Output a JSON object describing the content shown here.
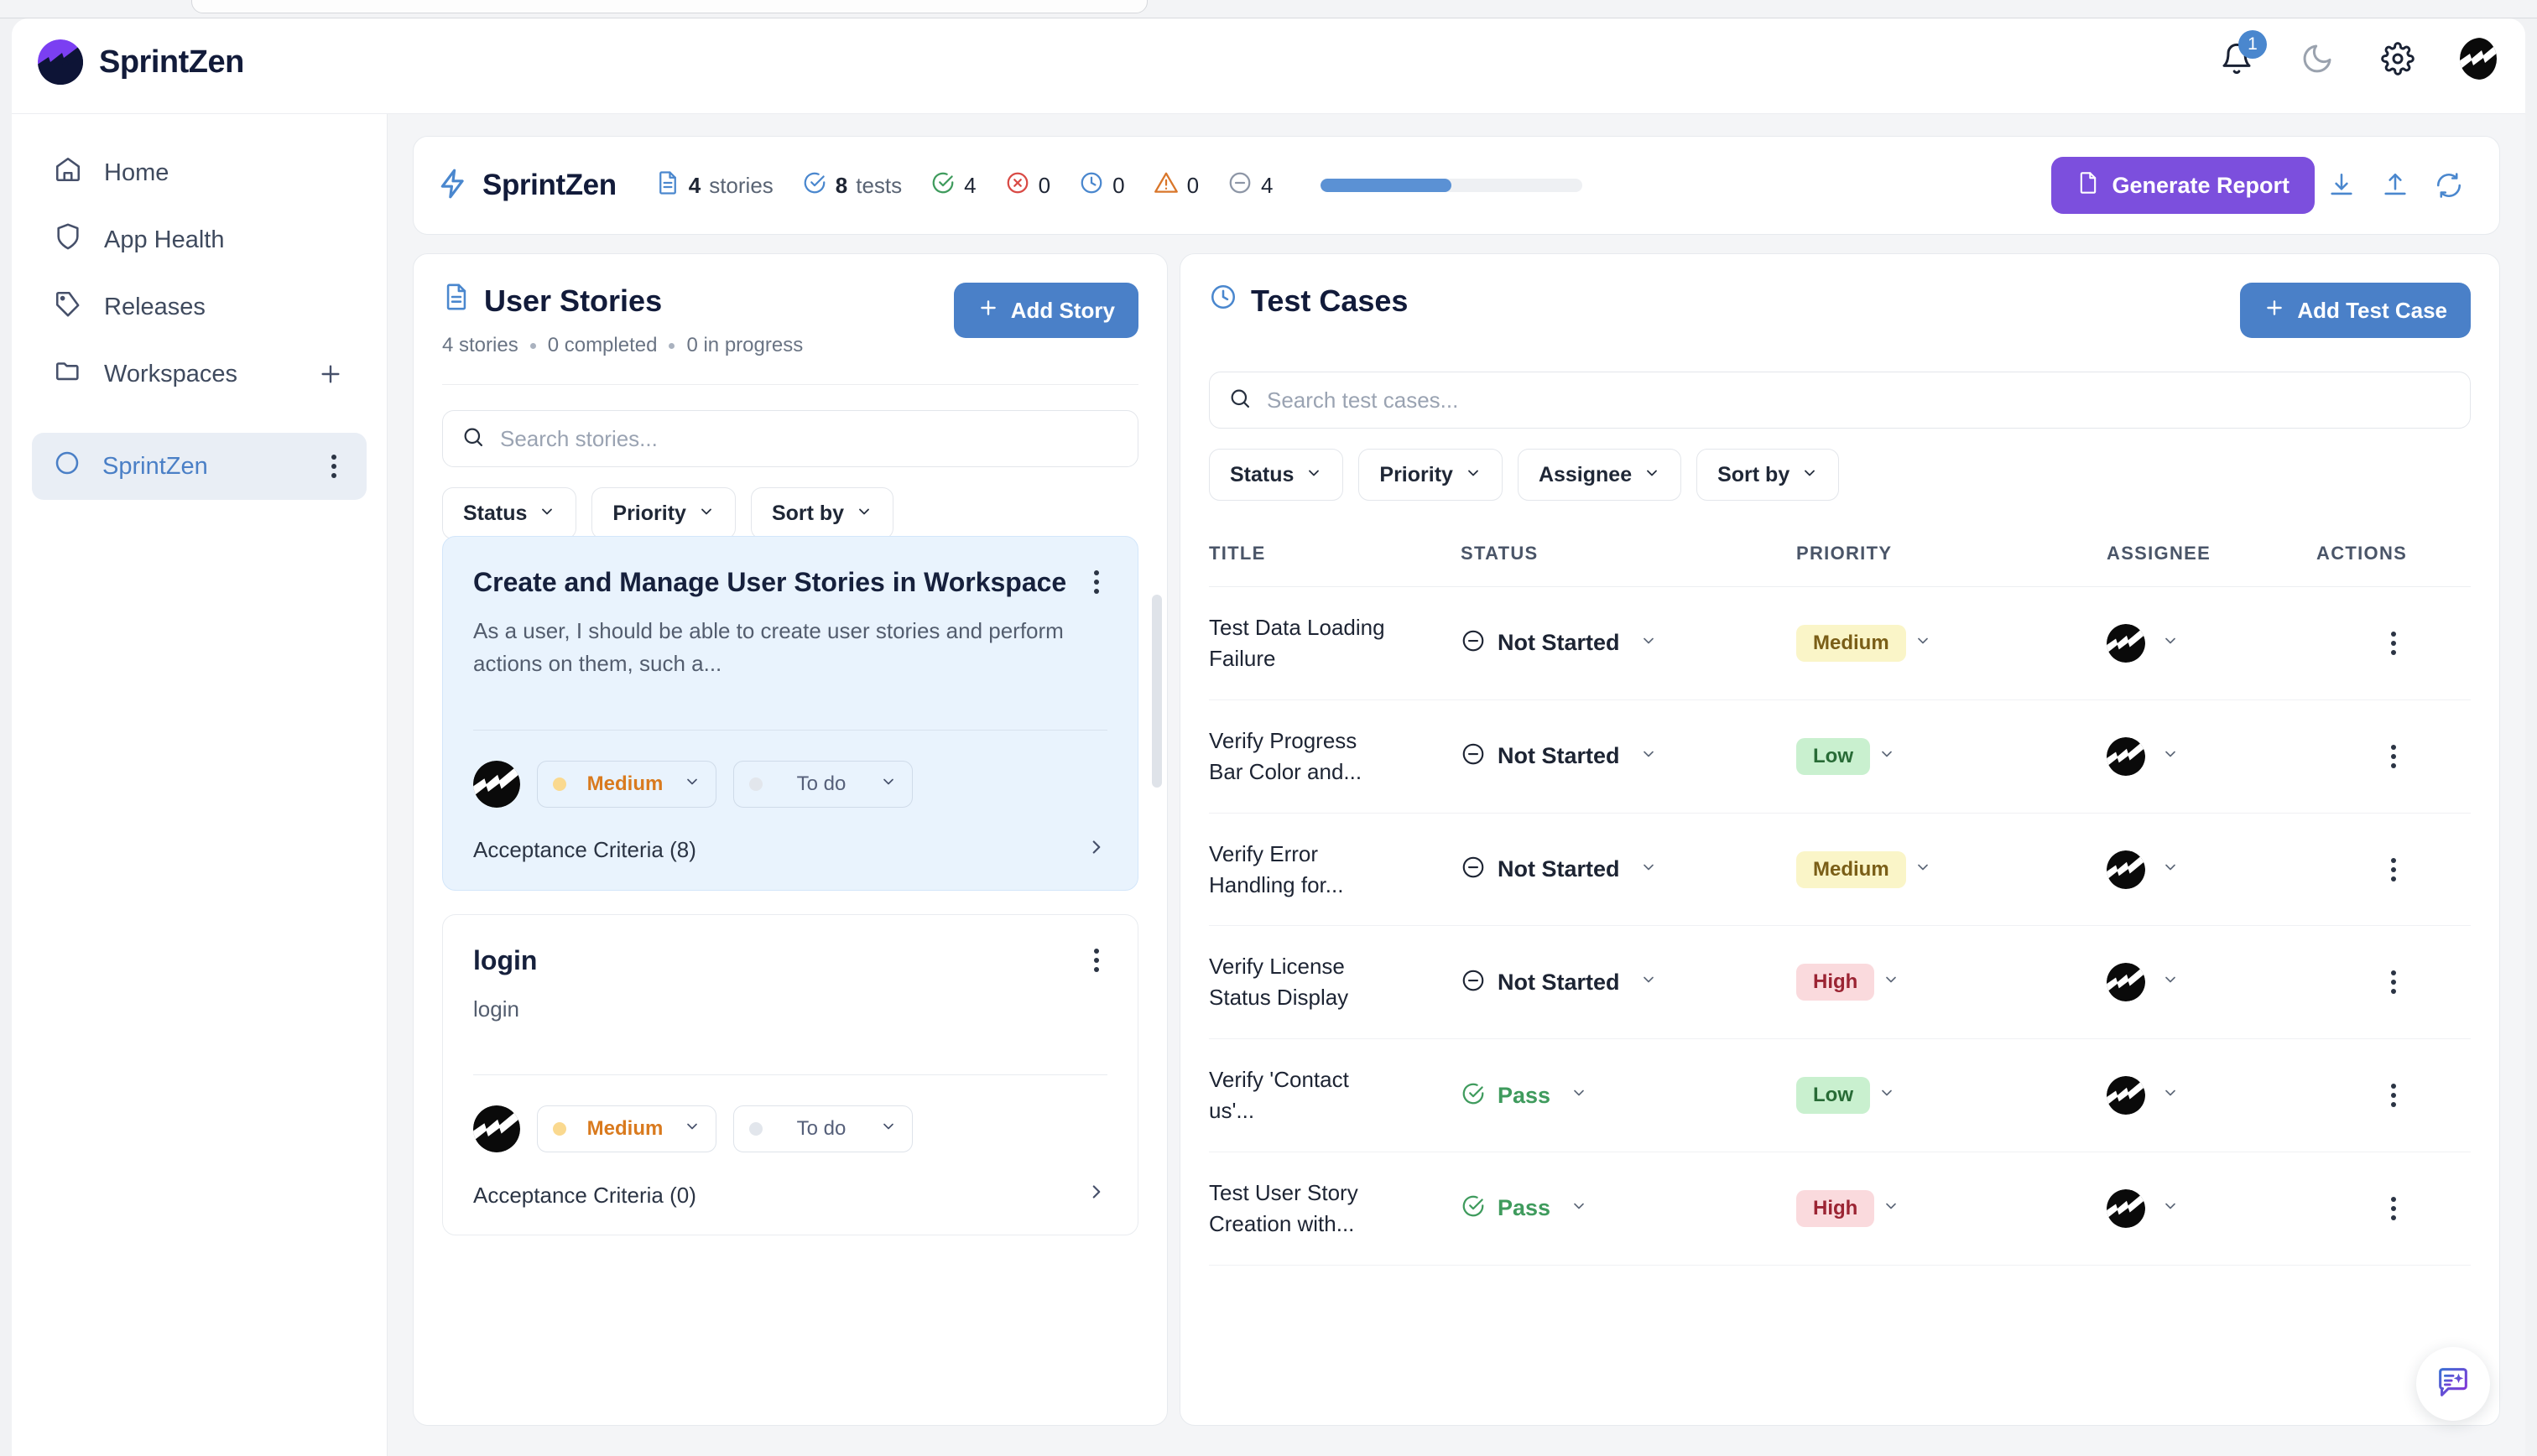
{
  "app": {
    "brand_name": "SprintZen",
    "notification_count": "1"
  },
  "topbar": {
    "icons": [
      "bell-icon",
      "moon-icon",
      "gear-icon",
      "user-avatar"
    ]
  },
  "sidebar": {
    "items": [
      {
        "label": "Home",
        "icon": "home-icon",
        "active": false
      },
      {
        "label": "App Health",
        "icon": "shield-icon",
        "active": false
      },
      {
        "label": "Releases",
        "icon": "tag-icon",
        "active": false
      },
      {
        "label": "Workspaces",
        "icon": "folder-icon",
        "active": false,
        "action": "add-workspace"
      }
    ],
    "workspace": {
      "label": "SprintZen",
      "icon": "circle-icon",
      "active": true
    }
  },
  "project_header": {
    "name": "SprintZen",
    "stats": [
      {
        "icon": "document-icon",
        "num": "4",
        "unit": "stories"
      },
      {
        "icon": "check-circle-icon",
        "num": "8",
        "unit": "tests"
      },
      {
        "icon": "check-pass-icon",
        "count": "4"
      },
      {
        "icon": "x-circle-icon",
        "count": "0"
      },
      {
        "icon": "clock-icon",
        "count": "0"
      },
      {
        "icon": "warning-triangle-icon",
        "count": "0"
      },
      {
        "icon": "minus-circle-icon",
        "count": "4"
      }
    ],
    "progress_percent": 50,
    "generate_report_label": "Generate Report",
    "actions": [
      "download-icon",
      "upload-icon",
      "refresh-icon"
    ]
  },
  "stories_panel": {
    "title": "User Stories",
    "summary_count": "4 stories",
    "summary_completed": "0 completed",
    "summary_inprogress": "0 in progress",
    "add_button_label": "Add Story",
    "search_placeholder": "Search stories...",
    "filters": [
      "Status",
      "Priority",
      "Sort by"
    ],
    "cards": [
      {
        "title": "Create and Manage User Stories in Workspace",
        "description": "As a user, I should be able to create user stories and perform actions on them, such a...",
        "priority": "Medium",
        "status": "To do",
        "acceptance_criteria": "Acceptance Criteria (8)",
        "selected": true
      },
      {
        "title": "login",
        "description": "login",
        "priority": "Medium",
        "status": "To do",
        "acceptance_criteria": "Acceptance Criteria (0)",
        "selected": false
      }
    ]
  },
  "tests_panel": {
    "title": "Test Cases",
    "add_button_label": "Add Test Case",
    "search_placeholder": "Search test cases...",
    "filters": [
      "Status",
      "Priority",
      "Assignee",
      "Sort by"
    ],
    "columns": [
      "TITLE",
      "STATUS",
      "PRIORITY",
      "ASSIGNEE",
      "ACTIONS"
    ],
    "rows": [
      {
        "title": "Test Data Loading Failure",
        "status": "Not Started",
        "status_kind": "notstarted",
        "priority": "Medium",
        "priority_kind": "medium"
      },
      {
        "title": "Verify Progress Bar Color and...",
        "status": "Not Started",
        "status_kind": "notstarted",
        "priority": "Low",
        "priority_kind": "low"
      },
      {
        "title": "Verify Error Handling for...",
        "status": "Not Started",
        "status_kind": "notstarted",
        "priority": "Medium",
        "priority_kind": "medium"
      },
      {
        "title": "Verify License Status Display",
        "status": "Not Started",
        "status_kind": "notstarted",
        "priority": "High",
        "priority_kind": "high"
      },
      {
        "title": "Verify 'Contact us'...",
        "status": "Pass",
        "status_kind": "pass",
        "priority": "Low",
        "priority_kind": "low"
      },
      {
        "title": "Test User Story Creation with...",
        "status": "Pass",
        "status_kind": "pass",
        "priority": "High",
        "priority_kind": "high"
      }
    ]
  },
  "fab": {
    "icon": "ai-chat-icon"
  },
  "colors": {
    "brand_purple": "#7c4fdd",
    "accent_blue": "#4a80c8",
    "pass_green": "#3f9b5d",
    "fail_red": "#d94a45",
    "warn_orange": "#d9762a",
    "priority_medium_bg": "#faf5c8",
    "priority_low_bg": "#c9f0cf",
    "priority_high_bg": "#fadadd"
  }
}
